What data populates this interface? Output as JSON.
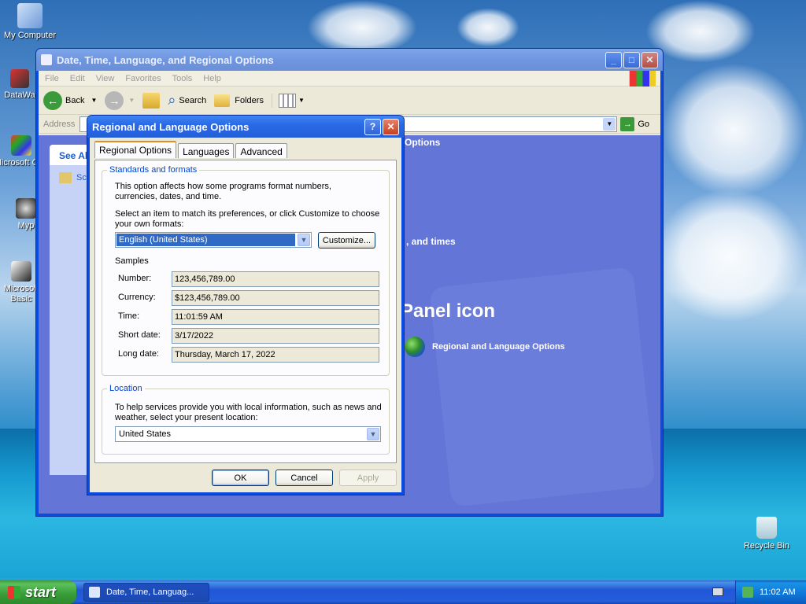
{
  "desktop": {
    "icons": [
      {
        "label": "My Computer"
      },
      {
        "label": "DataWa"
      },
      {
        "label": "Microsoft C++"
      },
      {
        "label": "Myp"
      },
      {
        "label": "Microsoft Basic"
      },
      {
        "label": "Recycle Bin"
      }
    ]
  },
  "explorer": {
    "title": "Date, Time, Language, and Regional Options",
    "menu": [
      "File",
      "Edit",
      "View",
      "Favorites",
      "Tools",
      "Help"
    ],
    "toolbar": {
      "back": "Back",
      "search": "Search",
      "folders": "Folders"
    },
    "address": {
      "label": "Address",
      "go": "Go"
    },
    "see_also": {
      "header": "See Als",
      "item": "Sch"
    },
    "content": {
      "options_fragment": "Options",
      "dates_fragment": ", and times",
      "panel_icon_heading": "Panel icon",
      "regional_link": "Regional and Language Options"
    }
  },
  "dialog": {
    "title": "Regional and Language Options",
    "tabs": [
      "Regional Options",
      "Languages",
      "Advanced"
    ],
    "standards": {
      "legend": "Standards and formats",
      "desc": "This option affects how some programs format numbers, currencies, dates, and time.",
      "prompt": "Select an item to match its preferences, or click Customize to choose your own formats:",
      "selected_format": "English (United States)",
      "customize_button": "Customize...",
      "samples_label": "Samples",
      "samples": [
        {
          "label": "Number:",
          "value": "123,456,789.00"
        },
        {
          "label": "Currency:",
          "value": "$123,456,789.00"
        },
        {
          "label": "Time:",
          "value": "11:01:59 AM"
        },
        {
          "label": "Short date:",
          "value": "3/17/2022"
        },
        {
          "label": "Long date:",
          "value": "Thursday, March 17, 2022"
        }
      ]
    },
    "location": {
      "legend": "Location",
      "desc": "To help services provide you with local information, such as news and weather, select your present location:",
      "selected": "United States"
    },
    "buttons": {
      "ok": "OK",
      "cancel": "Cancel",
      "apply": "Apply"
    }
  },
  "taskbar": {
    "start": "start",
    "task": "Date, Time, Languag...",
    "clock": "11:02 AM"
  }
}
